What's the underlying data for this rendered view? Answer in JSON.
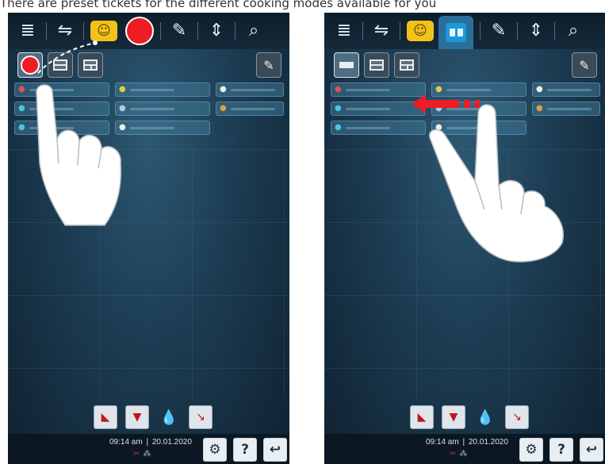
{
  "caption": "There are preset tickets for the different cooking modes available for you",
  "colors": {
    "accent": "#ee1c25",
    "active_tab": "#1a9ad8",
    "yellow_mode": "#f2c21b",
    "background": "#1c3c52"
  },
  "topbar": {
    "menu_icon": "≣",
    "filter_icon": "⇋",
    "chef_icon": "☺",
    "edit_icon": "✎",
    "height_icon": "⇕",
    "search_icon": "⌕"
  },
  "bottom_tools": {
    "drop_icon": "💧"
  },
  "status": {
    "time": "09:14 am",
    "separator": "|",
    "date": "20.01.2020",
    "icons": "✂",
    "fan": "⁂"
  },
  "buttons": {
    "settings_icon": "⚙",
    "help_label": "?",
    "back_icon": "↩"
  }
}
